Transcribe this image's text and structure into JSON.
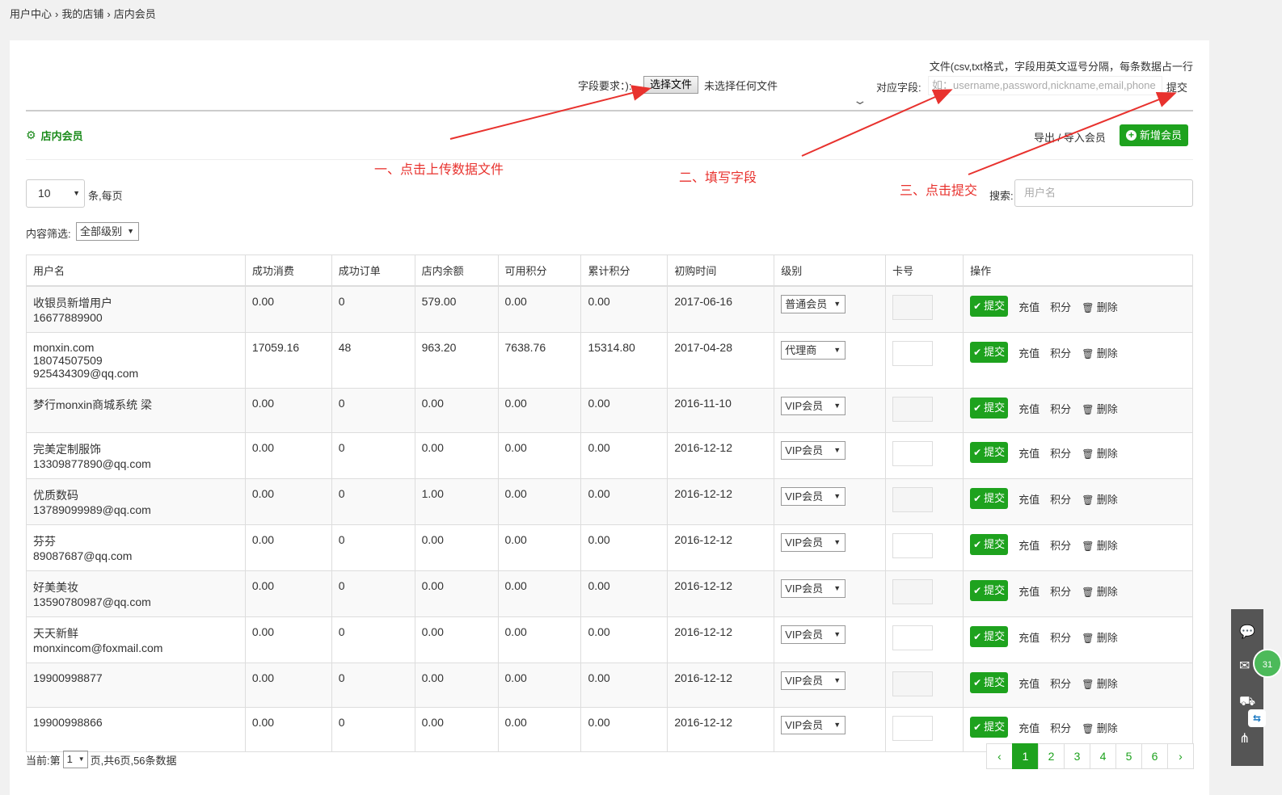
{
  "breadcrumb": [
    "用户中心",
    "›",
    "我的店铺",
    "›",
    "店内会员"
  ],
  "import": {
    "note": "文件(csv,txt格式，字段用英文逗号分隔，每条数据占一行",
    "file_requirement_label": "字段要求：):",
    "choose_file_label": "选择文件",
    "no_file_text": "未选择任何文件",
    "field_label": "对应字段:",
    "field_placeholder": "如：username,password,nickname,email,phone",
    "submit_label": "提交"
  },
  "section": {
    "title": "店内会员",
    "export_label": "导出 / 导入会员",
    "add_label": "新增会员"
  },
  "controls": {
    "per_page_value": "10",
    "per_page_label": "条,每页",
    "search_label": "搜索:",
    "search_placeholder": "用户名",
    "filter_label": "内容筛选:",
    "filter_value": "全部级别"
  },
  "annotations": {
    "step1": "一、点击上传数据文件",
    "step2": "二、填写字段",
    "step3": "三、点击提交"
  },
  "table": {
    "columns": [
      "用户名",
      "成功消费",
      "成功订单",
      "店内余额",
      "可用积分",
      "累计积分",
      "初购时间",
      "级别",
      "卡号",
      "操作"
    ],
    "rows": [
      {
        "name": "收银员新增用户",
        "extra": [
          "16677889900"
        ],
        "spent": "0.00",
        "orders": "0",
        "balance": "579.00",
        "points": "0.00",
        "total_points": "0.00",
        "first_buy": "2017-06-16",
        "level": "普通会员"
      },
      {
        "name": "monxin.com",
        "extra": [
          "18074507509",
          "925434309@qq.com"
        ],
        "spent": "17059.16",
        "orders": "48",
        "balance": "963.20",
        "points": "7638.76",
        "total_points": "15314.80",
        "first_buy": "2017-04-28",
        "level": "代理商"
      },
      {
        "name": "梦行monxin商城系统 梁",
        "extra": [],
        "spent": "0.00",
        "orders": "0",
        "balance": "0.00",
        "points": "0.00",
        "total_points": "0.00",
        "first_buy": "2016-11-10",
        "level": "VIP会员"
      },
      {
        "name": "完美定制服饰",
        "extra": [
          "13309877890@qq.com"
        ],
        "spent": "0.00",
        "orders": "0",
        "balance": "0.00",
        "points": "0.00",
        "total_points": "0.00",
        "first_buy": "2016-12-12",
        "level": "VIP会员"
      },
      {
        "name": "优质数码",
        "extra": [
          "13789099989@qq.com"
        ],
        "spent": "0.00",
        "orders": "0",
        "balance": "1.00",
        "points": "0.00",
        "total_points": "0.00",
        "first_buy": "2016-12-12",
        "level": "VIP会员"
      },
      {
        "name": "芬芬",
        "extra": [
          "89087687@qq.com"
        ],
        "spent": "0.00",
        "orders": "0",
        "balance": "0.00",
        "points": "0.00",
        "total_points": "0.00",
        "first_buy": "2016-12-12",
        "level": "VIP会员"
      },
      {
        "name": "好美美妆",
        "extra": [
          "13590780987@qq.com"
        ],
        "spent": "0.00",
        "orders": "0",
        "balance": "0.00",
        "points": "0.00",
        "total_points": "0.00",
        "first_buy": "2016-12-12",
        "level": "VIP会员"
      },
      {
        "name": "天天新鲜",
        "extra": [
          "monxincom@foxmail.com"
        ],
        "spent": "0.00",
        "orders": "0",
        "balance": "0.00",
        "points": "0.00",
        "total_points": "0.00",
        "first_buy": "2016-12-12",
        "level": "VIP会员"
      },
      {
        "name": "19900998877",
        "extra": [],
        "spent": "0.00",
        "orders": "0",
        "balance": "0.00",
        "points": "0.00",
        "total_points": "0.00",
        "first_buy": "2016-12-12",
        "level": "VIP会员"
      },
      {
        "name": "19900998866",
        "extra": [],
        "spent": "0.00",
        "orders": "0",
        "balance": "0.00",
        "points": "0.00",
        "total_points": "0.00",
        "first_buy": "2016-12-12",
        "level": "VIP会员"
      }
    ],
    "actions": {
      "submit": "提交",
      "recharge": "充值",
      "points": "积分",
      "delete": "删除"
    }
  },
  "footer": {
    "current_label": "当前:第",
    "page_value": "1",
    "summary": "页,共6页,56条数据"
  },
  "pagination": [
    "‹",
    "1",
    "2",
    "3",
    "4",
    "5",
    "6",
    "›"
  ],
  "sidebar": {
    "badge": "31",
    "tv_glyph": "⇆"
  },
  "colors": {
    "accent_green": "#1ea21e",
    "annotation_red": "#e8322e"
  }
}
